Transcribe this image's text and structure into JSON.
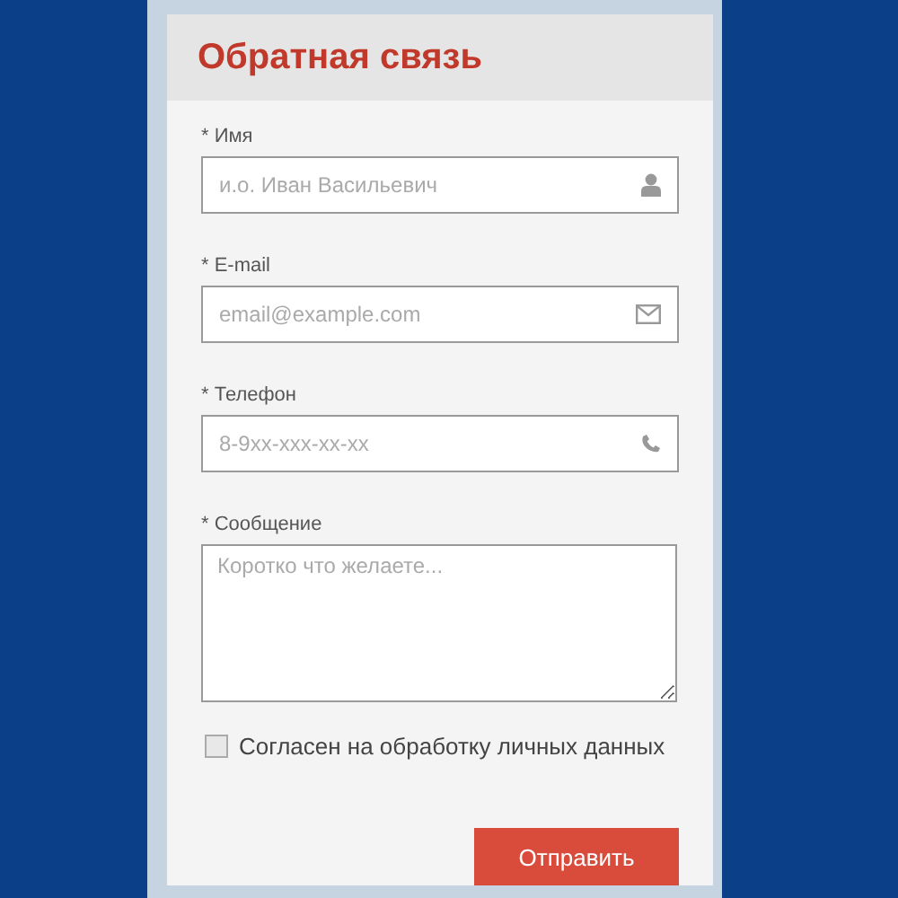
{
  "form": {
    "title": "Обратная связь",
    "fields": [
      {
        "kind": "name",
        "label": "* Имя",
        "placeholder": "и.о. Иван Васильевич"
      },
      {
        "kind": "email",
        "label": "* E-mail",
        "placeholder": "email@example.com"
      },
      {
        "kind": "phone",
        "label": "* Телефон",
        "placeholder": "8-9xx-xxx-xx-xx"
      },
      {
        "kind": "message",
        "label": "* Сообщение",
        "placeholder": "Коротко что желаете..."
      }
    ],
    "consent": {
      "label": "Согласен на обработку личных данных",
      "checked": false
    },
    "submit": "Отправить"
  }
}
